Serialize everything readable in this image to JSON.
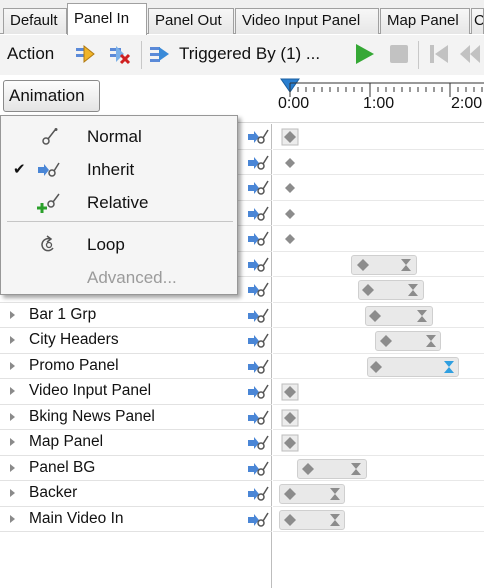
{
  "tabs": [
    {
      "label": "Default"
    },
    {
      "label": "Panel In"
    },
    {
      "label": "Panel Out"
    },
    {
      "label": "Video Input Panel"
    },
    {
      "label": "Map Panel"
    },
    {
      "label": "C"
    }
  ],
  "toolbar": {
    "action_label": "Action",
    "triggered_label": "Triggered By (1) ..."
  },
  "animation_button": {
    "label": "Animation"
  },
  "ruler": {
    "labels": [
      "0:00",
      "1:00",
      "2:00"
    ]
  },
  "menu": {
    "items": [
      {
        "label": "Normal",
        "checked": false,
        "icon": "normal-icon"
      },
      {
        "label": "Inherit",
        "checked": true,
        "icon": "inherit-icon"
      },
      {
        "label": "Relative",
        "checked": false,
        "icon": "relative-icon"
      },
      {
        "label": "Loop",
        "checked": false,
        "icon": "loop-icon"
      },
      {
        "label": "Advanced...",
        "checked": false,
        "disabled": true,
        "icon": ""
      }
    ]
  },
  "tracks": [
    {
      "label": ""
    },
    {
      "label": ""
    },
    {
      "label": ""
    },
    {
      "label": ""
    },
    {
      "label": ""
    },
    {
      "label": ""
    },
    {
      "label": ""
    },
    {
      "label": "Bar 1 Grp"
    },
    {
      "label": "City Headers"
    },
    {
      "label": "Promo Panel"
    },
    {
      "label": "Video Input Panel"
    },
    {
      "label": "Bking News Panel"
    },
    {
      "label": "Map Panel"
    },
    {
      "label": "Panel BG"
    },
    {
      "label": "Backer"
    },
    {
      "label": "Main Video In"
    }
  ],
  "colors": {
    "play_green": "#35a835",
    "keyframe_gray": "#8c8c8c",
    "end_selected_blue": "#2f9fe0",
    "playhead_blue": "#2a7fd0"
  }
}
